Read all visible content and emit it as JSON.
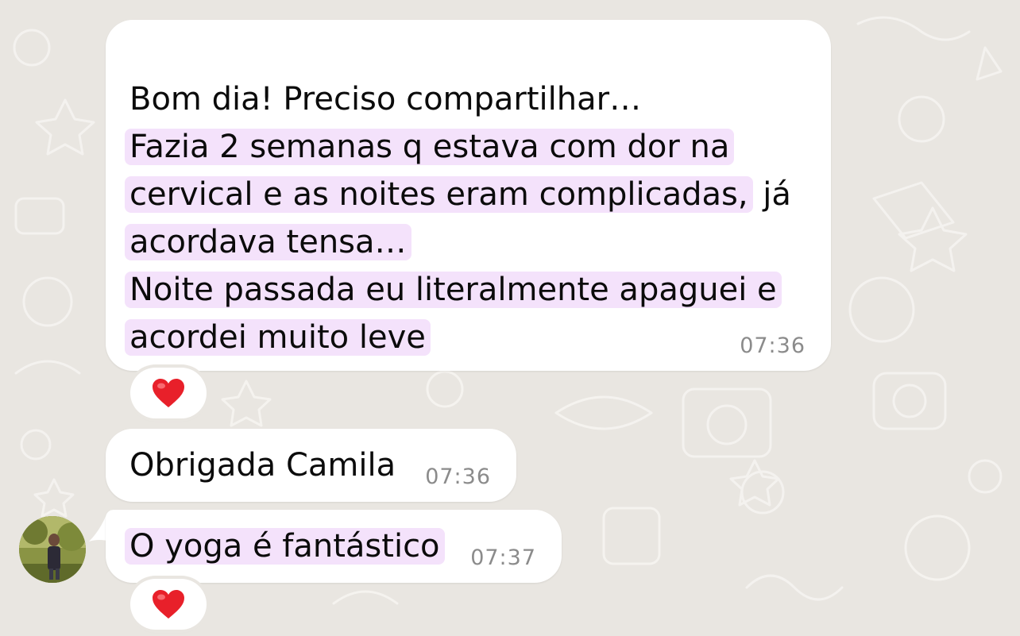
{
  "messages": [
    {
      "lines": [
        "Bom dia! Preciso compartilhar…",
        "Fazia 2 semanas q estava com dor na",
        "cervical e as noites eram complicadas,",
        " já",
        "acordava tensa…",
        "Noite passada eu literalmente apaguei e",
        "acordei muito leve"
      ],
      "time": "07:36",
      "reaction": "heart"
    },
    {
      "text": "Obrigada Camila",
      "time": "07:36"
    },
    {
      "text": "O yoga é fantástico",
      "time": "07:37",
      "reaction": "heart"
    }
  ],
  "colors": {
    "wallpaper": "#e9e6e1",
    "bubble": "#ffffff",
    "highlight": "#f4e2fb",
    "timestamp": "#8b8b8b",
    "heart": "#e8202a"
  },
  "icons": {
    "reaction": "heart-icon",
    "avatar": "contact-avatar"
  }
}
